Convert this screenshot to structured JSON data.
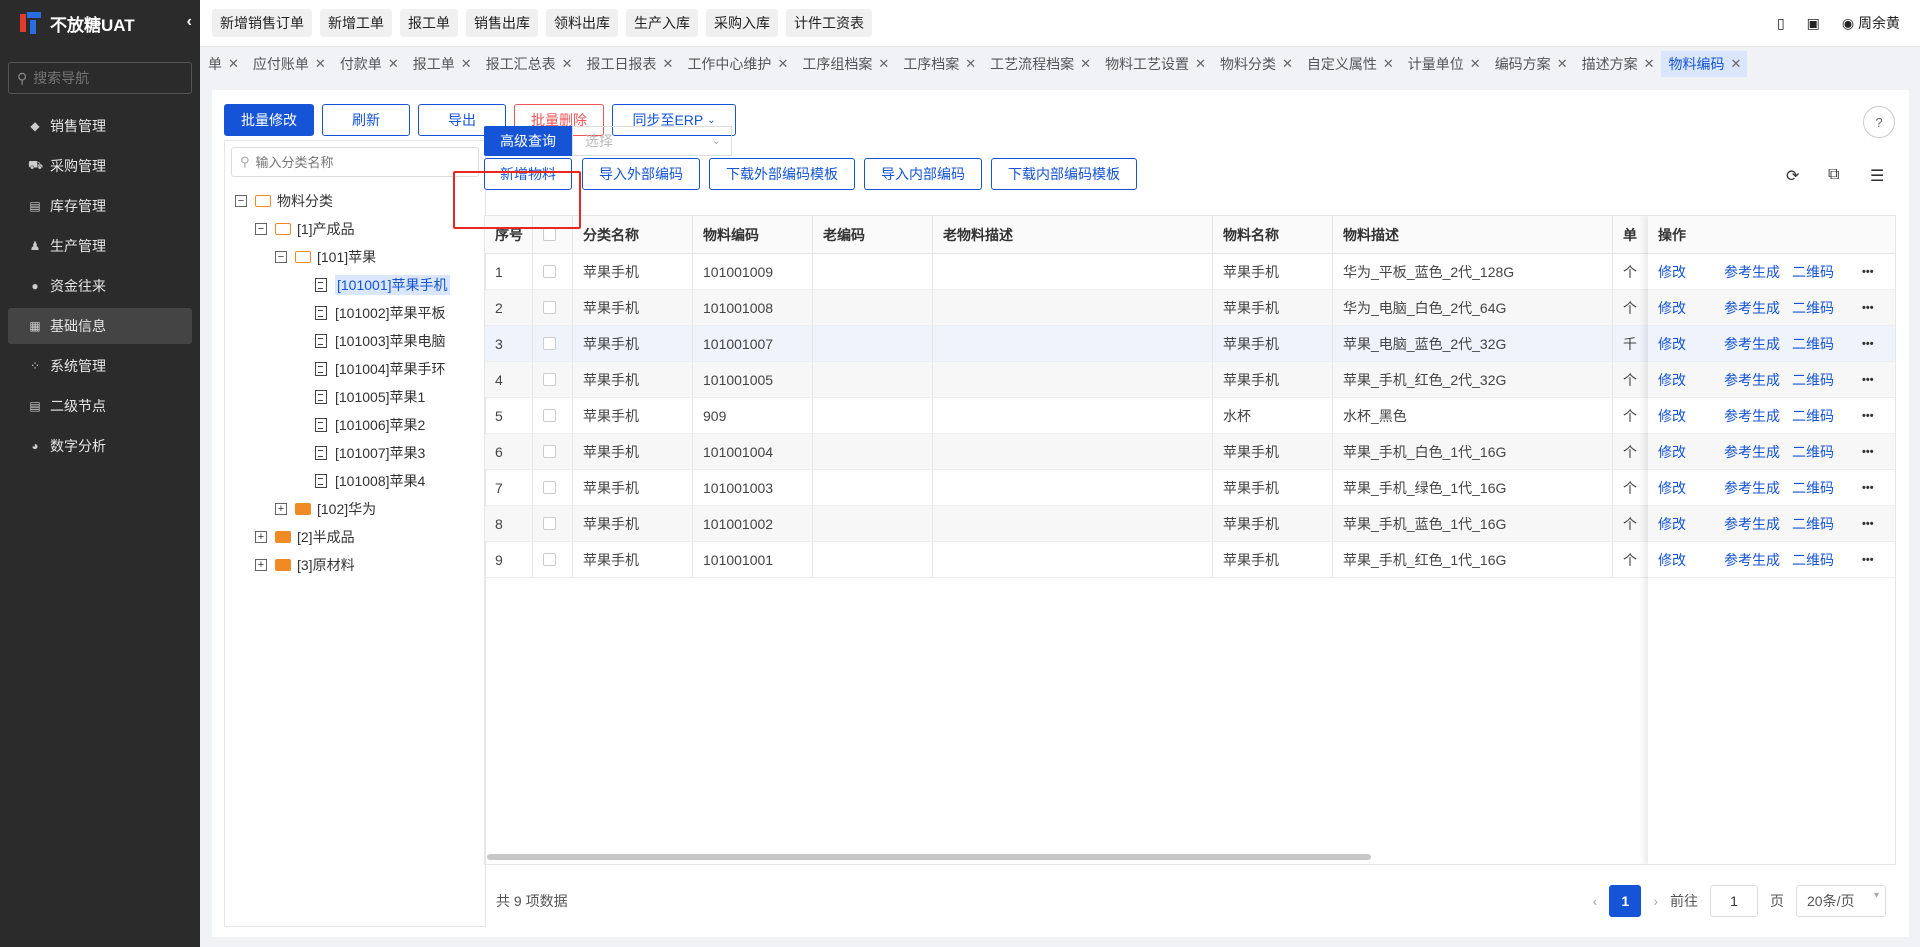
{
  "app": {
    "name": "不放糖UAT",
    "collapse_icon": "chevron-left-icon"
  },
  "nav": {
    "search_placeholder": "搜索导航",
    "items": [
      {
        "label": "销售管理",
        "icon": "tag-icon"
      },
      {
        "label": "采购管理",
        "icon": "cart-icon"
      },
      {
        "label": "库存管理",
        "icon": "box-icon"
      },
      {
        "label": "生产管理",
        "icon": "person-icon"
      },
      {
        "label": "资金往来",
        "icon": "money-icon"
      },
      {
        "label": "基础信息",
        "icon": "table-icon",
        "active": true
      },
      {
        "label": "系统管理",
        "icon": "grid-icon"
      },
      {
        "label": "二级节点",
        "icon": "doc-icon"
      },
      {
        "label": "数字分析",
        "icon": "pie-icon"
      }
    ]
  },
  "topbar": {
    "quick": [
      "新增销售订单",
      "新增工单",
      "报工单",
      "销售出库",
      "领料出库",
      "生产入库",
      "采购入库",
      "计件工资表"
    ],
    "user": "周余黄"
  },
  "tabs": [
    "单",
    "应付账单",
    "付款单",
    "报工单",
    "报工汇总表",
    "报工日报表",
    "工作中心维护",
    "工序组档案",
    "工序档案",
    "工艺流程档案",
    "物料工艺设置",
    "物料分类",
    "自定义属性",
    "计量单位",
    "编码方案",
    "描述方案",
    "物料编码"
  ],
  "toolbar": {
    "batch_edit": "批量修改",
    "refresh": "刷新",
    "export": "导出",
    "batch_delete": "批量删除",
    "sync_erp": "同步至ERP"
  },
  "tree": {
    "search_placeholder": "输入分类名称",
    "nodes": [
      "物料分类",
      "[1]产成品",
      "[101]苹果",
      "[101001]苹果手机",
      "[101002]苹果平板",
      "[101003]苹果电脑",
      "[101004]苹果手环",
      "[101005]苹果1",
      "[101006]苹果2",
      "[101007]苹果3",
      "[101008]苹果4",
      "[102]华为",
      "[2]半成品",
      "[3]原材料"
    ]
  },
  "query": {
    "advanced": "高级查询",
    "select_placeholder": "选择"
  },
  "ops_buttons": {
    "add": "新增物料",
    "import_ext": "导入外部编码",
    "download_ext": "下载外部编码模板",
    "import_int": "导入内部编码",
    "download_int": "下载内部编码模板"
  },
  "table": {
    "headers": [
      "序号",
      "",
      "分类名称",
      "物料编码",
      "老编码",
      "老物料描述",
      "物料名称",
      "物料描述",
      "单"
    ],
    "op_header": "操作",
    "op_links": [
      "修改",
      "参考生成",
      "二维码",
      "•••"
    ],
    "rows": [
      {
        "no": "1",
        "cat": "苹果手机",
        "code": "101001009",
        "old": "",
        "olddesc": "",
        "name": "苹果手机",
        "desc": "华为_平板_蓝色_2代_128G",
        "unit": "个"
      },
      {
        "no": "2",
        "cat": "苹果手机",
        "code": "101001008",
        "old": "",
        "olddesc": "",
        "name": "苹果手机",
        "desc": "华为_电脑_白色_2代_64G",
        "unit": "个"
      },
      {
        "no": "3",
        "cat": "苹果手机",
        "code": "101001007",
        "old": "",
        "olddesc": "",
        "name": "苹果手机",
        "desc": "苹果_电脑_蓝色_2代_32G",
        "unit": "千"
      },
      {
        "no": "4",
        "cat": "苹果手机",
        "code": "101001005",
        "old": "",
        "olddesc": "",
        "name": "苹果手机",
        "desc": "苹果_手机_红色_2代_32G",
        "unit": "个"
      },
      {
        "no": "5",
        "cat": "苹果手机",
        "code": "909",
        "old": "",
        "olddesc": "",
        "name": "水杯",
        "desc": "水杯_黑色",
        "unit": "个"
      },
      {
        "no": "6",
        "cat": "苹果手机",
        "code": "101001004",
        "old": "",
        "olddesc": "",
        "name": "苹果手机",
        "desc": "苹果_手机_白色_1代_16G",
        "unit": "个"
      },
      {
        "no": "7",
        "cat": "苹果手机",
        "code": "101001003",
        "old": "",
        "olddesc": "",
        "name": "苹果手机",
        "desc": "苹果_手机_绿色_1代_16G",
        "unit": "个"
      },
      {
        "no": "8",
        "cat": "苹果手机",
        "code": "101001002",
        "old": "",
        "olddesc": "",
        "name": "苹果手机",
        "desc": "苹果_手机_蓝色_1代_16G",
        "unit": "个"
      },
      {
        "no": "9",
        "cat": "苹果手机",
        "code": "101001001",
        "old": "",
        "olddesc": "",
        "name": "苹果手机",
        "desc": "苹果_手机_红色_1代_16G",
        "unit": "个"
      }
    ]
  },
  "pager": {
    "total": "共 9 项数据",
    "current": "1",
    "goto": "前往",
    "page_value": "1",
    "page_suffix": "页",
    "size": "20条/页"
  },
  "colors": {
    "primary": "#1554d6",
    "danger": "#e55555",
    "highlight": "#e8281e"
  }
}
